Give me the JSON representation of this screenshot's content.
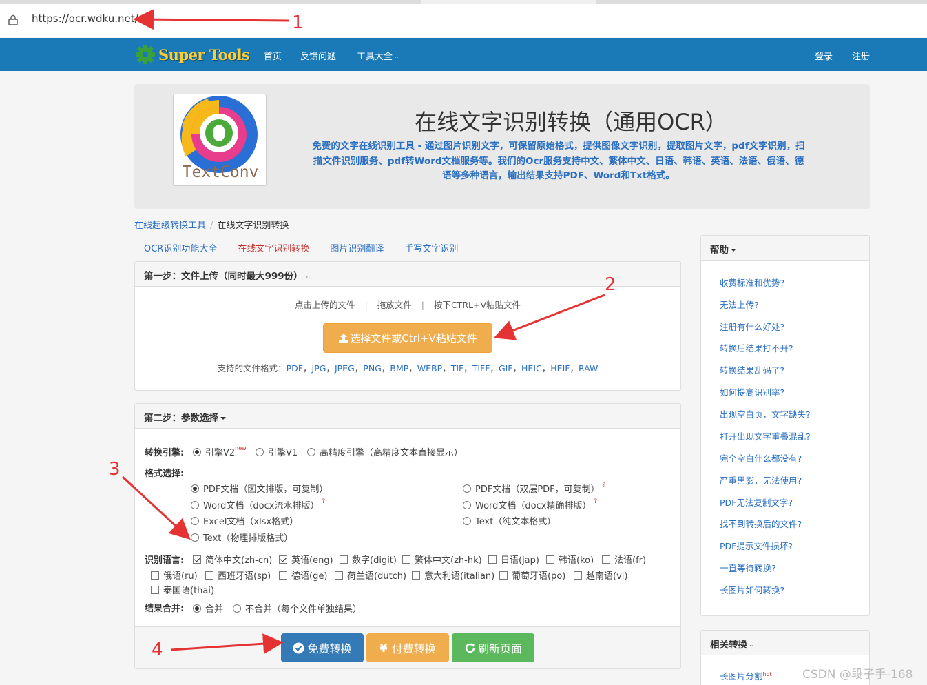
{
  "browser": {
    "url": "https://ocr.wdku.net/"
  },
  "navbar": {
    "logo_text": "Super Tools",
    "items": [
      "首页",
      "反馈问题",
      "工具大全"
    ],
    "right": [
      "登录",
      "注册"
    ]
  },
  "hero": {
    "logo_text": "TextConv",
    "title": "在线文字识别转换（通用OCR）",
    "description_lines": [
      "免费的文字在线识别工具 - 通过图片识别文字，可保留原始格式，提供图像文字识别，提取图片文字，pdf文字识别，扫",
      "描文件识别服务、pdf转Word文档服务等。我们的Ocr服务支持中文、繁体中文、日语、韩语、英语、法语、俄语、德",
      "语等多种语言，输出结果支持PDF、Word和Txt格式。"
    ]
  },
  "breadcrumb": [
    "在线超级转换工具",
    "在线文字识别转换"
  ],
  "tabs": [
    {
      "label": "OCR识别功能大全",
      "active": false
    },
    {
      "label": "在线文字识别转换",
      "active": true
    },
    {
      "label": "图片识别翻译",
      "active": false
    },
    {
      "label": "手写文字识别",
      "active": false
    }
  ],
  "step1": {
    "title": "第一步：文件上传（同时最大999份）",
    "hints": [
      "点击上传的文件",
      "拖放文件",
      "按下CTRL+V粘贴文件"
    ],
    "upload_button": "选择文件或Ctrl+V粘贴文件",
    "formats_label": "支持的文件格式：",
    "formats": [
      "PDF",
      "JPG",
      "JPEG",
      "PNG",
      "BMP",
      "WEBP",
      "TIF",
      "TIFF",
      "GIF",
      "HEIC",
      "HEIF",
      "RAW"
    ]
  },
  "step2": {
    "title": "第二步：参数选择",
    "engine_label": "转换引擎:",
    "engines": [
      {
        "label": "引擎V2",
        "sup": "new",
        "checked": true
      },
      {
        "label": "引擎V1",
        "checked": false
      },
      {
        "label": "高精度引擎（高精度文本直接显示）",
        "checked": false
      }
    ],
    "format_label": "格式选择:",
    "formats": [
      {
        "label": "PDF文档（图文排版，可复制）",
        "checked": true,
        "help": false
      },
      {
        "label": "PDF文档（双层PDF，可复制）",
        "checked": false,
        "help": true
      },
      {
        "label": "Word文档（docx流水排版）",
        "checked": false,
        "help": true
      },
      {
        "label": "Word文档（docx精确排版）",
        "checked": false,
        "help": true
      },
      {
        "label": "Excel文档（xlsx格式）",
        "checked": false,
        "help": false
      },
      {
        "label": "Text（纯文本格式）",
        "checked": false,
        "help": false
      },
      {
        "label": "Text（物理排版格式）",
        "checked": false,
        "help": false
      }
    ],
    "help_mark": "?",
    "lang_label": "识别语言:",
    "languages": [
      {
        "label": "简体中文(zh-cn)",
        "checked": true
      },
      {
        "label": "英语(eng)",
        "checked": true
      },
      {
        "label": "数字(digit)",
        "checked": false
      },
      {
        "label": "繁体中文(zh-hk)",
        "checked": false
      },
      {
        "label": "日语(jap)",
        "checked": false
      },
      {
        "label": "韩语(ko)",
        "checked": false
      },
      {
        "label": "法语(fr)",
        "checked": false
      },
      {
        "label": "俄语(ru)",
        "checked": false
      },
      {
        "label": "西班牙语(sp)",
        "checked": false
      },
      {
        "label": "德语(ge)",
        "checked": false
      },
      {
        "label": "荷兰语(dutch)",
        "checked": false
      },
      {
        "label": "意大利语(italian)",
        "checked": false
      },
      {
        "label": "葡萄牙语(po)",
        "checked": false
      },
      {
        "label": "越南语(vi)",
        "checked": false
      },
      {
        "label": "泰国语(thai)",
        "checked": false
      }
    ],
    "merge_label": "结果合并:",
    "merge_options": [
      {
        "label": "合并",
        "checked": true
      },
      {
        "label": "不合并（每个文件单独结果）",
        "checked": false
      }
    ],
    "buttons": [
      {
        "label": "免费转换",
        "color": "#337ab7"
      },
      {
        "label": "付费转换",
        "color": "#f0ad4e"
      },
      {
        "label": "刷新页面",
        "color": "#5cb85c"
      }
    ]
  },
  "help": {
    "title": "帮助",
    "links": [
      "收费标准和优势?",
      "无法上传?",
      "注册有什么好处?",
      "转换后结果打不开?",
      "转换结果乱码了?",
      "如何提高识别率?",
      "出现空白页，文字缺失?",
      "打开出现文字重叠混乱?",
      "完全空白什么都没有?",
      "严重黑影，无法使用?",
      "PDF无法复制文字?",
      "找不到转换后的文件?",
      "PDF提示文件损坏?",
      "一直等待转换?",
      "长图片如何转换?"
    ]
  },
  "related": {
    "title": "相关转换",
    "first_link": "长图片分割",
    "first_link_sup": "hot"
  },
  "annotations": [
    "1",
    "2",
    "3",
    "4"
  ],
  "watermark": "CSDN @段子手-168",
  "colors": {
    "nav_blue": "#1a7ab8",
    "link_blue": "#2a6fc2",
    "active_red": "#c9302c",
    "annotation_red": "#e53333",
    "logo_yellow": "#ffcc33"
  }
}
